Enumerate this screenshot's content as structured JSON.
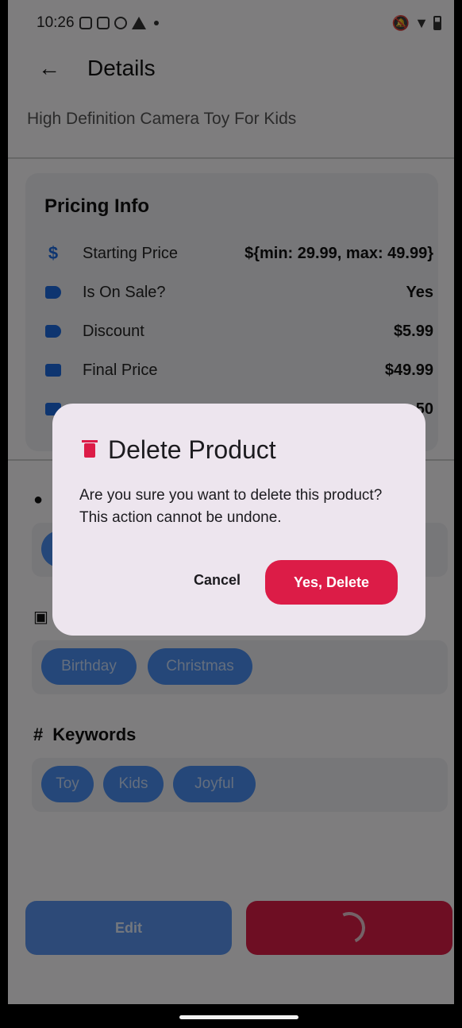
{
  "status": {
    "time": "10:26"
  },
  "appbar": {
    "title": "Details",
    "back_icon": "arrow-left-icon"
  },
  "product": {
    "name": "High Definition Camera Toy For Kids"
  },
  "pricing": {
    "title": "Pricing Info",
    "rows": [
      {
        "icon": "dollar-icon",
        "label": "Starting Price",
        "value": "${min: 29.99, max: 49.99}"
      },
      {
        "icon": "tag-icon",
        "label": "Is On Sale?",
        "value": "Yes"
      },
      {
        "icon": "discount-tag-icon",
        "label": "Discount",
        "value": "$5.99"
      },
      {
        "icon": "price-card-icon",
        "label": "Final Price",
        "value": "$49.99"
      },
      {
        "icon": "card-icon",
        "label": "",
        "value": "50"
      }
    ]
  },
  "occasions": {
    "chips": [
      "Birthday",
      "Christmas"
    ]
  },
  "keywords": {
    "title": "Keywords",
    "chips": [
      "Toy",
      "Kids",
      "Joyful"
    ]
  },
  "actions": {
    "edit_label": "Edit"
  },
  "dialog": {
    "title": "Delete Product",
    "message": "Are you sure you want to delete this product? This action cannot be undone.",
    "cancel_label": "Cancel",
    "confirm_label": "Yes, Delete"
  },
  "colors": {
    "accent": "#dc1c47",
    "chip": "#4a8ef2",
    "primary": "#5b95f0"
  }
}
